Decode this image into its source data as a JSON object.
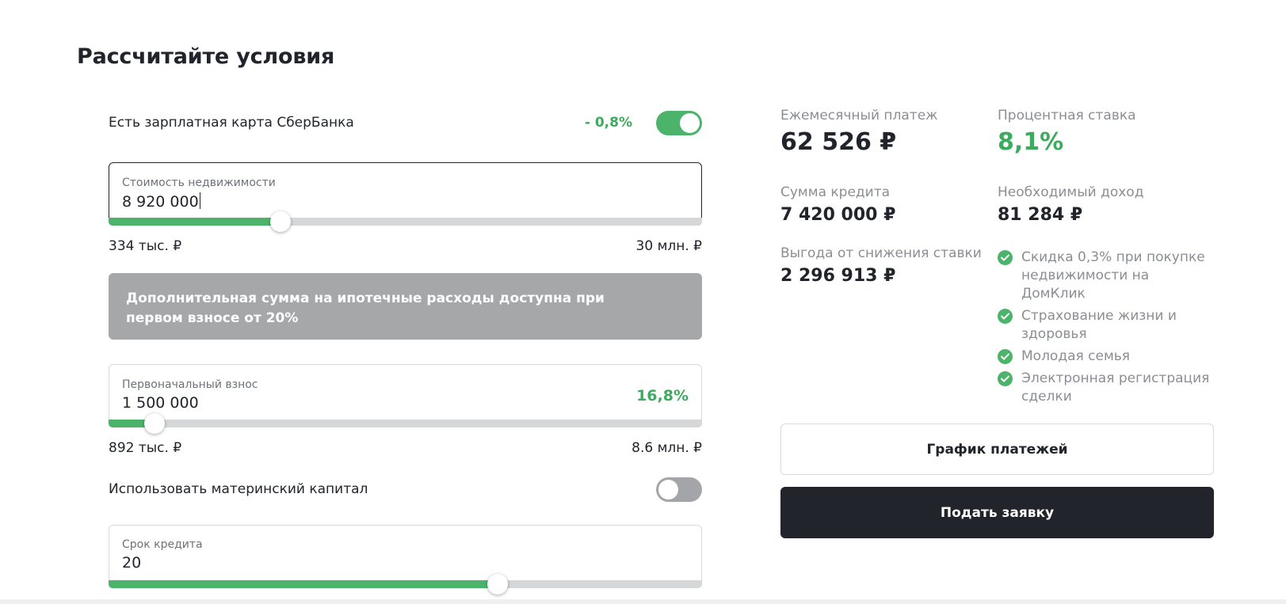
{
  "title": "Рассчитайте условия",
  "salary_card": {
    "label": "Есть зарплатная карта СберБанка",
    "discount": "- 0,8%",
    "enabled": true
  },
  "property_cost": {
    "label": "Стоимость недвижимости",
    "value": "8 920 000",
    "min_label": "334 тыс. ₽",
    "max_label": "30 млн. ₽",
    "slider_fraction": 0.29
  },
  "notice": {
    "text": "Дополнительная сумма на ипотечные расходы доступна при первом взносе от 20%"
  },
  "down_payment": {
    "label": "Первоначальный взнос",
    "value": "1 500 000",
    "percent": "16,8%",
    "min_label": "892 тыс. ₽",
    "max_label": "8.6 млн. ₽",
    "slider_fraction": 0.078
  },
  "maternity_capital": {
    "label": "Использовать материнский капитал",
    "enabled": false
  },
  "loan_term": {
    "label": "Срок кредита",
    "value": "20",
    "slider_fraction": 0.656
  },
  "results": {
    "monthly_payment": {
      "label": "Ежемесячный платеж",
      "value": "62 526 ₽"
    },
    "interest_rate": {
      "label": "Процентная ставка",
      "value": "8,1%"
    },
    "loan_amount": {
      "label": "Сумма кредита",
      "value": "7 420 000 ₽"
    },
    "required_income": {
      "label": "Необходимый доход",
      "value": "81 284 ₽"
    },
    "rate_benefit": {
      "label": "Выгода от снижения ставки",
      "value": "2 296 913 ₽"
    }
  },
  "benefits": [
    "Скидка 0,3% при покупке недвижимости на ДомКлик",
    "Страхование жизни и здоровья",
    "Молодая семья",
    "Электронная регистрация сделки"
  ],
  "buttons": {
    "schedule": "График платежей",
    "apply": "Подать заявку"
  },
  "colors": {
    "accent_green": "#4cb36b",
    "text_dark": "#21242a",
    "notice_gray": "#a6a7a9"
  }
}
